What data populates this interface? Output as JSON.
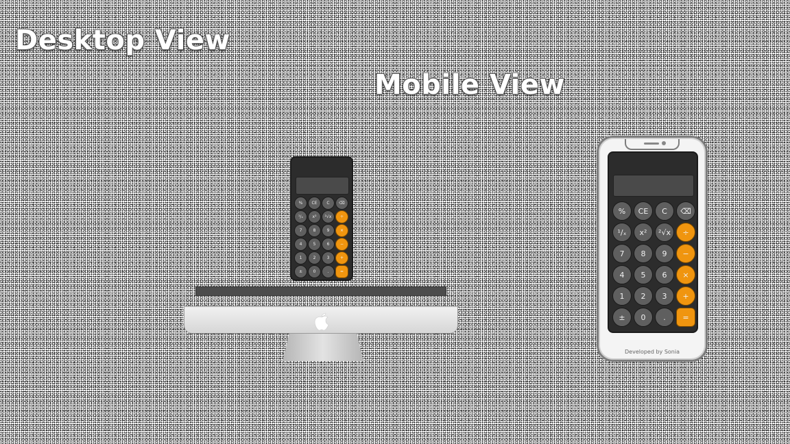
{
  "headings": {
    "desktop": "Desktop View",
    "mobile": "Mobile View"
  },
  "colors": {
    "operator": "#f0950f",
    "key": "#5f5f5f",
    "body": "#2c2c2c",
    "display": "#4a4a4a"
  },
  "desktop_keys": [
    {
      "label": "%",
      "op": false
    },
    {
      "label": "CE",
      "op": false
    },
    {
      "label": "C",
      "op": false
    },
    {
      "label": "⌫",
      "op": false
    },
    {
      "label": "¹/ₓ",
      "op": false
    },
    {
      "label": "x²",
      "op": false
    },
    {
      "label": "²√x",
      "op": false
    },
    {
      "label": "÷",
      "op": true
    },
    {
      "label": "7",
      "op": false
    },
    {
      "label": "8",
      "op": false
    },
    {
      "label": "9",
      "op": false
    },
    {
      "label": "×",
      "op": true
    },
    {
      "label": "4",
      "op": false
    },
    {
      "label": "5",
      "op": false
    },
    {
      "label": "6",
      "op": false
    },
    {
      "label": "−",
      "op": true
    },
    {
      "label": "1",
      "op": false
    },
    {
      "label": "2",
      "op": false
    },
    {
      "label": "3",
      "op": false
    },
    {
      "label": "+",
      "op": true
    },
    {
      "label": "±",
      "op": false
    },
    {
      "label": "0",
      "op": false
    },
    {
      "label": ".",
      "op": false
    },
    {
      "label": "=",
      "op": true
    }
  ],
  "mobile_keys": [
    {
      "label": "%",
      "op": false
    },
    {
      "label": "CE",
      "op": false
    },
    {
      "label": "C",
      "op": false
    },
    {
      "label": "⌫",
      "op": false
    },
    {
      "label": "¹/ₓ",
      "op": false
    },
    {
      "label": "x²",
      "op": false
    },
    {
      "label": "²√x",
      "op": false
    },
    {
      "label": "÷",
      "op": true
    },
    {
      "label": "7",
      "op": false
    },
    {
      "label": "8",
      "op": false
    },
    {
      "label": "9",
      "op": false
    },
    {
      "label": "−",
      "op": true
    },
    {
      "label": "4",
      "op": false
    },
    {
      "label": "5",
      "op": false
    },
    {
      "label": "6",
      "op": false
    },
    {
      "label": "×",
      "op": true
    },
    {
      "label": "1",
      "op": false
    },
    {
      "label": "2",
      "op": false
    },
    {
      "label": "3",
      "op": false
    },
    {
      "label": "+",
      "op": true
    },
    {
      "label": "±",
      "op": false
    },
    {
      "label": "0",
      "op": false
    },
    {
      "label": ".",
      "op": false
    },
    {
      "label": "=",
      "op": true
    }
  ],
  "footer": {
    "credit": "Developed by Sonia"
  }
}
